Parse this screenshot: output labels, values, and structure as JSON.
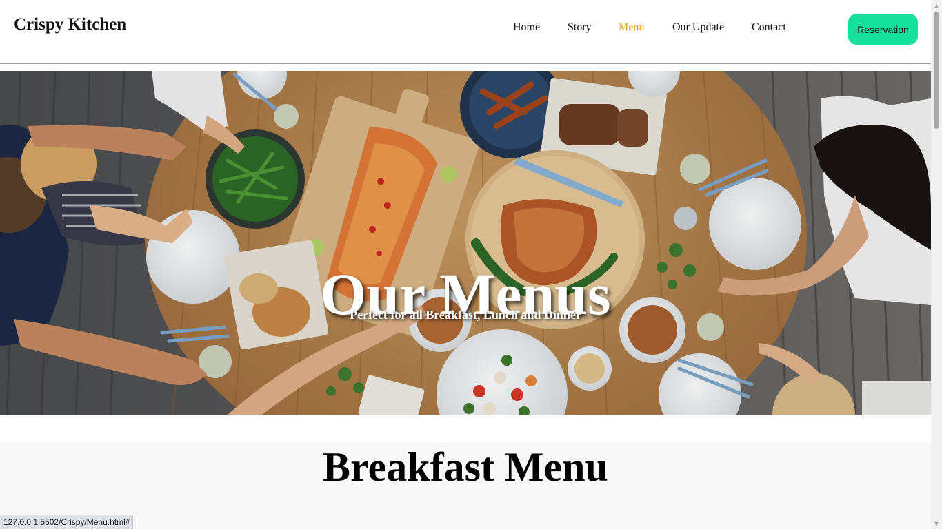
{
  "header": {
    "brand": "Crispy Kitchen",
    "nav_items": [
      {
        "label": "Home"
      },
      {
        "label": "Story"
      },
      {
        "label": "Menu"
      },
      {
        "label": "Our Update"
      },
      {
        "label": "Contact"
      }
    ],
    "reservation_label": "Reservation",
    "active_color": "#e8a02b",
    "reservation_color": "#16e09c"
  },
  "hero": {
    "title": "Our Menus",
    "subtitle": "Perfect for all Breakfast, Lunch and Dinner"
  },
  "section": {
    "title": "Breakfast Menu"
  },
  "status_bar": {
    "url": "127.0.0.1:5502/Crispy/Menu.html#"
  }
}
